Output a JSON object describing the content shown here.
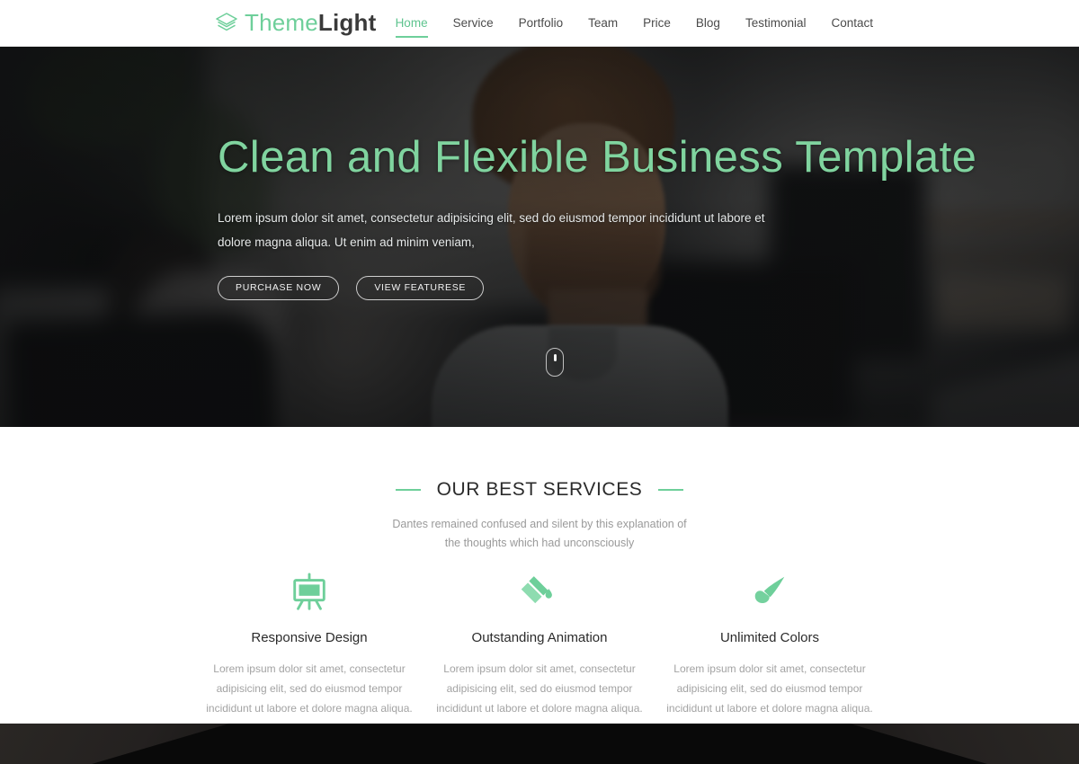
{
  "header": {
    "logo": {
      "icon": "layers-stack-icon",
      "text_primary": "Theme",
      "text_secondary": "Light"
    },
    "nav": [
      {
        "label": "Home",
        "active": true
      },
      {
        "label": "Service",
        "active": false
      },
      {
        "label": "Portfolio",
        "active": false
      },
      {
        "label": "Team",
        "active": false
      },
      {
        "label": "Price",
        "active": false
      },
      {
        "label": "Blog",
        "active": false
      },
      {
        "label": "Testimonial",
        "active": false
      },
      {
        "label": "Contact",
        "active": false
      }
    ]
  },
  "hero": {
    "title": "Clean and Flexible Business Template",
    "subtitle": "Lorem ipsum dolor sit amet, consectetur adipisicing elit, sed do eiusmod tempor incididunt ut labore et dolore magna aliqua. Ut enim ad minim veniam,",
    "primary_button": "PURCHASE NOW",
    "secondary_button": "VIEW FEATURESE",
    "scroll_indicator_icon": "scroll-mouse-icon"
  },
  "services_section": {
    "title": "OUR BEST SERVICES",
    "subtitle": "Dantes remained confused and silent by this explanation of the thoughts which had unconsciously",
    "items": [
      {
        "icon": "easel-presentation-icon",
        "name": "Responsive Design",
        "text": "Lorem ipsum dolor sit amet, consectetur adipisicing elit, sed do eiusmod tempor incididunt ut labore et dolore magna aliqua. Ut enim ad minim"
      },
      {
        "icon": "paint-bucket-icon",
        "name": "Outstanding Animation",
        "text": "Lorem ipsum dolor sit amet, consectetur adipisicing elit, sed do eiusmod tempor incididunt ut labore et dolore magna aliqua. Ut enim ad minim"
      },
      {
        "icon": "paint-brush-icon",
        "name": "Unlimited Colors",
        "text": "Lorem ipsum dolor sit amet, consectetur adipisicing elit, sed do eiusmod tempor incididunt ut labore et dolore magna aliqua. Ut enim ad minim"
      }
    ]
  },
  "colors": {
    "accent_green": "#6ecf9a",
    "hero_title_green": "#80d49f",
    "nav_text": "#4b4b4b",
    "heading_dark": "#2b2b2b",
    "body_gray": "#a3a3a3",
    "dark_section": "#090909"
  }
}
